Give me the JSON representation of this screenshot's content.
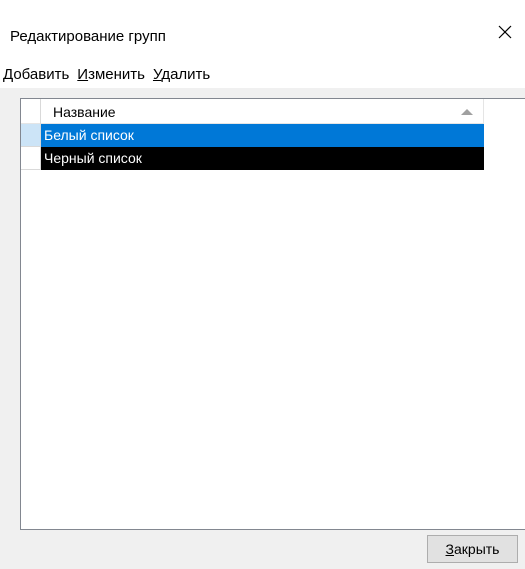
{
  "window": {
    "title": "Редактирование групп",
    "close_icon": "close-icon"
  },
  "menu": {
    "items": [
      {
        "accel": "Д",
        "rest": "обавить"
      },
      {
        "accel": "И",
        "rest": "зменить"
      },
      {
        "accel": "У",
        "rest": "далить"
      }
    ]
  },
  "list": {
    "columns": [
      {
        "label": "Название",
        "sort": "ascending"
      }
    ],
    "rows": [
      {
        "name": "Белый список",
        "state": "selected"
      },
      {
        "name": "Черный список",
        "state": "highlighted-dark"
      }
    ]
  },
  "footer": {
    "close_button": {
      "accel": "З",
      "rest": "акрыть"
    }
  },
  "colors": {
    "selection": "#0078d7",
    "selection_indicator": "#cce4f7",
    "dark_row": "#000000",
    "window_bg": "#f0f0f0"
  }
}
